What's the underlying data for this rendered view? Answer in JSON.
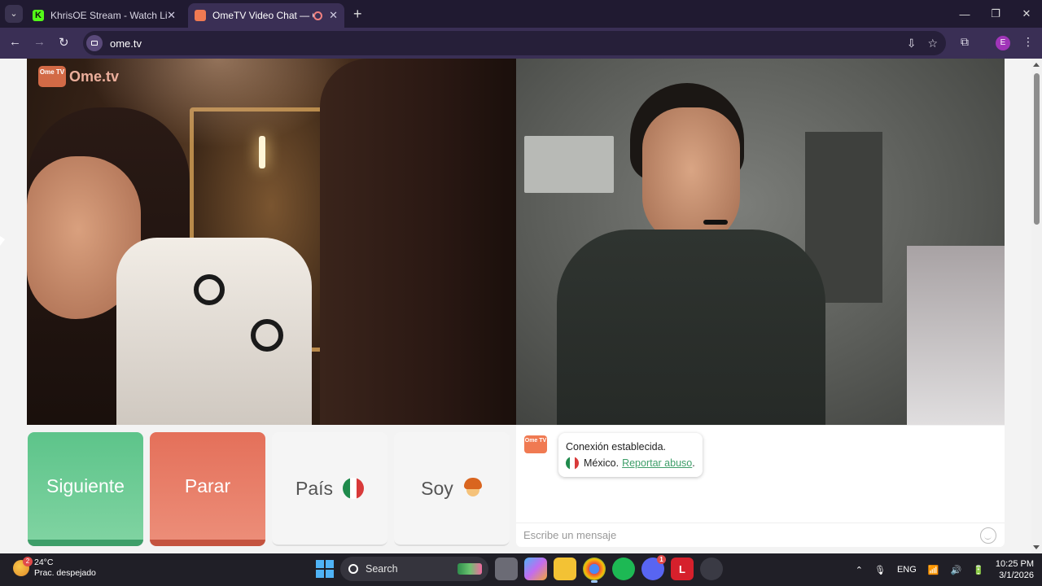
{
  "browser": {
    "tabs": [
      {
        "title": "KhrisOE Stream - Watch Live on Kick",
        "favicon_color": "#53fc18",
        "favicon_letter": "K",
        "active": false
      },
      {
        "title": "OmeTV Video Chat — OmeTV",
        "favicon_color": "#f07a52",
        "favicon_letter": "",
        "active": true
      }
    ],
    "url": "ome.tv",
    "profile_initial": "E"
  },
  "video": {
    "logo_badge": "Ome TV",
    "logo_text": "Ome.tv"
  },
  "controls": {
    "next_label": "Siguiente",
    "stop_label": "Parar",
    "country_label": "País",
    "iam_label": "Soy"
  },
  "chat": {
    "logo_badge": "Ome TV",
    "status": "Conexión establecida.",
    "country": "México.",
    "report_link": "Reportar abuso",
    "report_suffix": ".",
    "input_placeholder": "Escribe un mensaje"
  },
  "taskbar": {
    "weather_badge": "2",
    "temperature": "24°C",
    "weather_desc": "Prac. despejado",
    "search_label": "Search",
    "discord_badge": "1",
    "language": "ENG",
    "time": "10:25 PM",
    "date": "3/1/2026"
  },
  "colors": {
    "next_button": "#5dc48a",
    "stop_button": "#e4705a",
    "brand": "#f07a52",
    "link": "#3e9e69"
  }
}
